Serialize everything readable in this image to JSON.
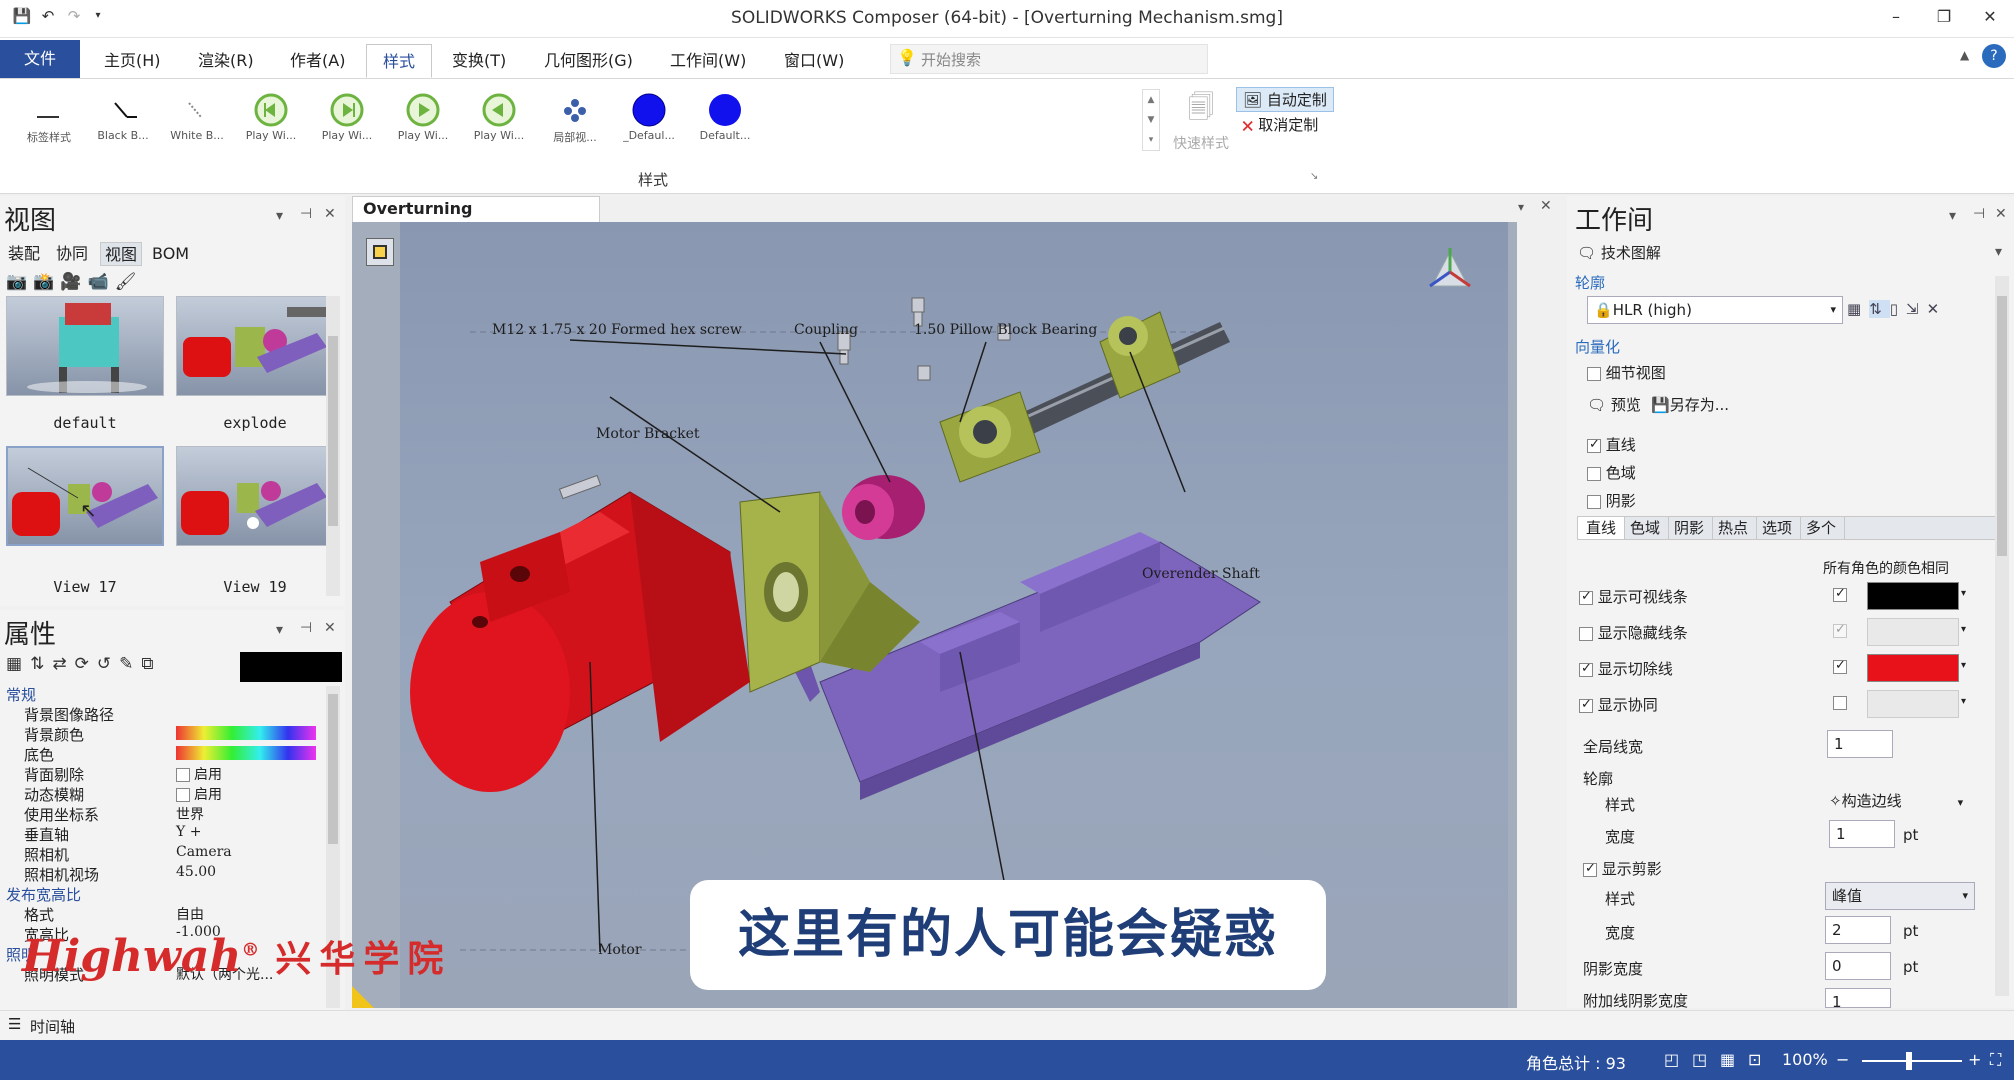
{
  "window": {
    "title": "SOLIDWORKS Composer (64-bit) - [Overturning Mechanism.smg]"
  },
  "ribbon": {
    "tabs": [
      "文件",
      "主页(H)",
      "渲染(R)",
      "作者(A)",
      "样式",
      "变换(T)",
      "几何图形(G)",
      "工作间(W)",
      "窗口(W)"
    ],
    "active_tab": "样式",
    "search_placeholder": "开始搜索",
    "gallery": [
      "标签样式",
      "Black B...",
      "White B...",
      "Play Wi...",
      "Play Wi...",
      "Play Wi...",
      "Play Wi...",
      "局部视...",
      "_Defaul...",
      "Default..."
    ],
    "quick_style": "快速样式",
    "auto_custom": "自动定制",
    "cancel_custom": "取消定制",
    "group_label": "样式"
  },
  "views_panel": {
    "title": "视图",
    "tabs": [
      "装配",
      "协同",
      "视图",
      "BOM"
    ],
    "active_tab": "视图",
    "thumbnails": [
      "default",
      "explode",
      "View 17",
      "View 19"
    ]
  },
  "properties_panel": {
    "title": "属性",
    "rows": [
      {
        "type": "cat",
        "label": "常规"
      },
      {
        "label": "背景图像路径",
        "value": ""
      },
      {
        "label": "背景颜色",
        "value": ""
      },
      {
        "label": "底色",
        "value": ""
      },
      {
        "label": "背面剔除",
        "value": "启用"
      },
      {
        "label": "动态模糊",
        "value": "启用"
      },
      {
        "label": "使用坐标系",
        "value": "世界"
      },
      {
        "label": "垂直轴",
        "value": "Y +"
      },
      {
        "label": "照相机",
        "value": "Camera"
      },
      {
        "label": "照相机视场",
        "value": "45.00"
      },
      {
        "type": "cat",
        "label": "发布宽高比"
      },
      {
        "label": "格式",
        "value": "自由"
      },
      {
        "label": "宽高比",
        "value": "-1.000"
      },
      {
        "type": "cat",
        "label": "照明"
      },
      {
        "label": "照明模式",
        "value": "默认（两个光..."
      }
    ]
  },
  "document_tab": "Overturning Mechanism.smg",
  "callouts": [
    "M12 x 1.75 x 20 Formed hex screw",
    "Coupling",
    "1.50 Pillow Block Bearing",
    "Motor Bracket",
    "Overender Shaft",
    "Motor"
  ],
  "subtitle": "这里有的人可能会疑惑",
  "watermark": {
    "latin": "Highwah",
    "chinese": "兴华学院",
    "mark": "®"
  },
  "workspace": {
    "title": "工作间",
    "header": "技术图解",
    "section_outline": "轮廓",
    "render_mode": "HLR (high)",
    "section_vector": "向量化",
    "detail_view": "细节视图",
    "preview": "预览",
    "save_as": "另存为...",
    "checks": [
      {
        "label": "直线",
        "checked": true
      },
      {
        "label": "色域",
        "checked": false
      },
      {
        "label": "阴影",
        "checked": false
      }
    ],
    "subtabs": [
      "直线",
      "色域",
      "阴影",
      "热点",
      "选项",
      "多个"
    ],
    "same_color_label": "所有角色的颜色相同",
    "line_options": [
      {
        "label": "显示可视线条",
        "checked": true,
        "same": true,
        "color": "#000000"
      },
      {
        "label": "显示隐藏线条",
        "checked": false,
        "same": true,
        "color": ""
      },
      {
        "label": "显示切除线",
        "checked": true,
        "same": true,
        "color": "#e8121b"
      },
      {
        "label": "显示协同",
        "checked": true,
        "same": false,
        "color": ""
      }
    ],
    "global_width_label": "全局线宽",
    "global_width": "1",
    "outline_label": "轮廓",
    "style_label": "样式",
    "outline_style": "构造边线",
    "width_label": "宽度",
    "outline_width": "1",
    "unit": "pt",
    "show_clip": "显示剪影",
    "clip_style": "峰值",
    "clip_width": "2",
    "shadow_width_label": "阴影宽度",
    "shadow_width": "0",
    "extra_label": "附加线阴影宽度",
    "extra_width": "1"
  },
  "statusbar": {
    "timeline": "时间轴",
    "actor_count": "角色总计 : 93",
    "zoom": "100%"
  }
}
